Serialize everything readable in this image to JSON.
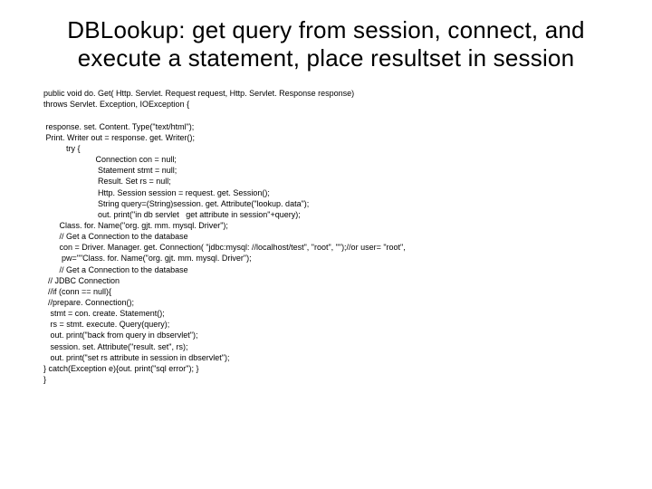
{
  "title": "DBLookup: get query from session, connect, and execute a statement, place resultset in session",
  "code_lines": [
    "public void do. Get( Http. Servlet. Request request, Http. Servlet. Response response)",
    "throws Servlet. Exception, IOException {",
    "",
    " response. set. Content. Type(\"text/html\");",
    " Print. Writer out = response. get. Writer();",
    "          try {",
    "                       Connection con = null;",
    "                        Statement stmt = null;",
    "                        Result. Set rs = null;",
    "                        Http. Session session = request. get. Session();",
    "                        String query=(String)session. get. Attribute(\"lookup. data\");",
    "                        out. print(\"in db servlet   get attribute in session\"+query);",
    "       Class. for. Name(\"org. gjt. mm. mysql. Driver\");",
    "       // Get a Connection to the database",
    "       con = Driver. Manager. get. Connection( \"jdbc:mysql: //localhost/test\", \"root\", \"\");//or user= \"root\",",
    "        pw=\"\"Class. for. Name(\"org. gjt. mm. mysql. Driver\");",
    "       // Get a Connection to the database",
    "  // JDBC Connection",
    "  //if (conn == null){",
    "  //prepare. Connection();",
    "   stmt = con. create. Statement();",
    "   rs = stmt. execute. Query(query);",
    "   out. print(\"back from query in dbservlet\");",
    "   session. set. Attribute(\"result. set\", rs);",
    "   out. print(\"set rs attribute in session in dbservlet\");",
    "} catch(Exception e){out. print(\"sql error\"); }",
    "}"
  ]
}
